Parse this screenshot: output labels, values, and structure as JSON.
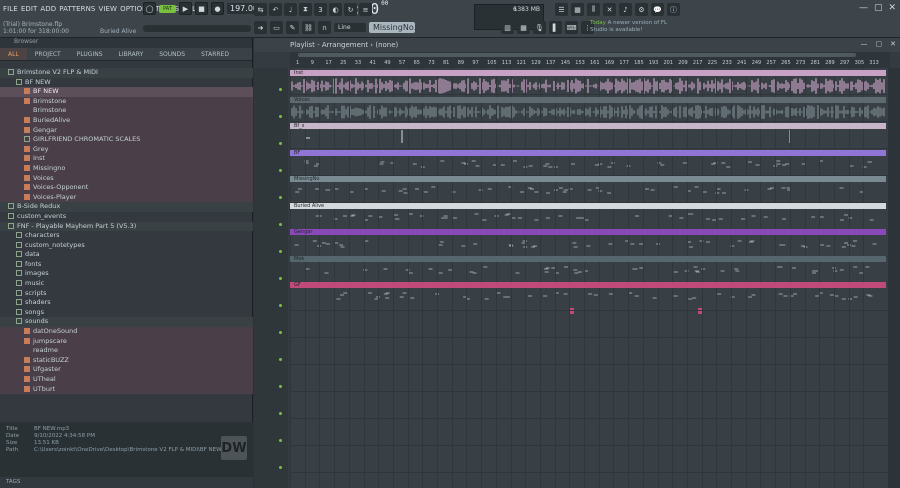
{
  "menu": [
    "FILE",
    "EDIT",
    "ADD",
    "PATTERNS",
    "VIEW",
    "OPTIONS",
    "TOOLS",
    "HELP"
  ],
  "project": {
    "title": "(Trial) Brimstone.flp",
    "time": "1:01:00 for 318:00:00",
    "hint": "Buried Alive"
  },
  "transport": {
    "pattern": "PAT",
    "tempo": "197.000"
  },
  "clock": {
    "time": "0:00",
    "ms": "00",
    "label": "M:S:CS"
  },
  "cpu": {
    "voices": "6",
    "mem": "1383 MB",
    "poly": "0"
  },
  "snap": "Line",
  "missing": "MissingNo...",
  "news": {
    "date": "Today",
    "text": "A newer version of FL Studio is available!"
  },
  "browser": {
    "title": "Browser",
    "tabs": [
      "ALL",
      "PROJECT",
      "PLUGINS",
      "LIBRARY",
      "SOUNDS",
      "STARRED"
    ],
    "items": [
      {
        "label": "Brimstone V2 FLP & MIDI",
        "type": "fold",
        "indent": 1,
        "cls": "hl"
      },
      {
        "label": "BF NEW",
        "type": "fold",
        "indent": 2,
        "cls": ""
      },
      {
        "label": "BF NEW",
        "type": "file",
        "indent": 3,
        "cls": "sel2"
      },
      {
        "label": "Brimstone",
        "type": "file",
        "indent": 3,
        "cls": "sel"
      },
      {
        "label": "Brimstone",
        "type": "txt",
        "indent": 3,
        "cls": "sel"
      },
      {
        "label": "BuriedAlive",
        "type": "file",
        "indent": 3,
        "cls": "sel"
      },
      {
        "label": "Gengar",
        "type": "file",
        "indent": 3,
        "cls": "sel"
      },
      {
        "label": "GIRLFRIEND CHROMATIC SCALES",
        "type": "fold",
        "indent": 3,
        "cls": "sel"
      },
      {
        "label": "Grey",
        "type": "file",
        "indent": 3,
        "cls": "sel"
      },
      {
        "label": "Inst",
        "type": "file",
        "indent": 3,
        "cls": "sel"
      },
      {
        "label": "Missingno",
        "type": "file",
        "indent": 3,
        "cls": "sel"
      },
      {
        "label": "Voices",
        "type": "file",
        "indent": 3,
        "cls": "sel"
      },
      {
        "label": "Voices-Opponent",
        "type": "file",
        "indent": 3,
        "cls": "sel"
      },
      {
        "label": "Voices-Player",
        "type": "file",
        "indent": 3,
        "cls": "sel"
      },
      {
        "label": "B-Side Redux",
        "type": "fold",
        "indent": 1,
        "cls": "hl"
      },
      {
        "label": "custom_events",
        "type": "fold",
        "indent": 1,
        "cls": ""
      },
      {
        "label": "FNF - Playable Mayhem Part 5 (V5.3)",
        "type": "fold",
        "indent": 1,
        "cls": "hl"
      },
      {
        "label": "characters",
        "type": "fold",
        "indent": 2,
        "cls": ""
      },
      {
        "label": "custom_notetypes",
        "type": "fold",
        "indent": 2,
        "cls": ""
      },
      {
        "label": "data",
        "type": "fold",
        "indent": 2,
        "cls": ""
      },
      {
        "label": "fonts",
        "type": "fold",
        "indent": 2,
        "cls": ""
      },
      {
        "label": "images",
        "type": "fold",
        "indent": 2,
        "cls": ""
      },
      {
        "label": "music",
        "type": "fold",
        "indent": 2,
        "cls": ""
      },
      {
        "label": "scripts",
        "type": "fold",
        "indent": 2,
        "cls": ""
      },
      {
        "label": "shaders",
        "type": "fold",
        "indent": 2,
        "cls": ""
      },
      {
        "label": "songs",
        "type": "fold",
        "indent": 2,
        "cls": ""
      },
      {
        "label": "sounds",
        "type": "fold",
        "indent": 2,
        "cls": "hl"
      },
      {
        "label": "datOneSound",
        "type": "file",
        "indent": 3,
        "cls": "sel"
      },
      {
        "label": "jumpscare",
        "type": "file",
        "indent": 3,
        "cls": "sel"
      },
      {
        "label": "readme",
        "type": "txt",
        "indent": 3,
        "cls": "sel"
      },
      {
        "label": "staticBUZZ",
        "type": "file",
        "indent": 3,
        "cls": "sel"
      },
      {
        "label": "Ufgaster",
        "type": "file",
        "indent": 3,
        "cls": "sel"
      },
      {
        "label": "UTheal",
        "type": "file",
        "indent": 3,
        "cls": "sel"
      },
      {
        "label": "UTburt",
        "type": "file",
        "indent": 3,
        "cls": "sel"
      }
    ],
    "info": {
      "title_k": "Title",
      "title": "BF NEW.mp3",
      "date_k": "Date",
      "date": "9/10/2022 4:34:58 PM",
      "size_k": "Size",
      "size": "13.51 KB",
      "path_k": "Path",
      "path": "C:\\Users\\zoinkt\\OneDrive\\Desktop\\Brimstone V2 FLP & MIDI\\BF NEW.mp3"
    },
    "logo": "DW",
    "tags": "TAGS"
  },
  "playlist": {
    "title": "Playlist - Arrangement",
    "sep": "›",
    "pattern": "(none)",
    "ticks": [
      "1",
      "9",
      "17",
      "25",
      "33",
      "41",
      "49",
      "57",
      "65",
      "73",
      "81",
      "89",
      "97",
      "105",
      "113",
      "121",
      "129",
      "137",
      "145",
      "153",
      "161",
      "169",
      "177",
      "185",
      "193",
      "201",
      "209",
      "217",
      "225",
      "233",
      "241",
      "249",
      "257",
      "265",
      "273",
      "281",
      "289",
      "297",
      "305",
      "313"
    ],
    "clips": [
      {
        "label": "Inst",
        "color": "#c8a2c4"
      },
      {
        "label": "Voices",
        "color": "#5e6a70"
      },
      {
        "label": "Bf_s",
        "color": "#c7b6c9"
      },
      {
        "label": "BF",
        "color": "#8f75d6"
      },
      {
        "label": "MissingNo",
        "color": "#7a8a92"
      },
      {
        "label": "Buried Alive",
        "color": "#d3d9dc"
      },
      {
        "label": "Gengar",
        "color": "#8a49b8"
      },
      {
        "label": "Mok",
        "color": "#56666e"
      },
      {
        "label": "GF",
        "color": "#c04a79"
      }
    ]
  },
  "colors": {
    "accent": "#7ac142",
    "bg": "#2b3338"
  }
}
